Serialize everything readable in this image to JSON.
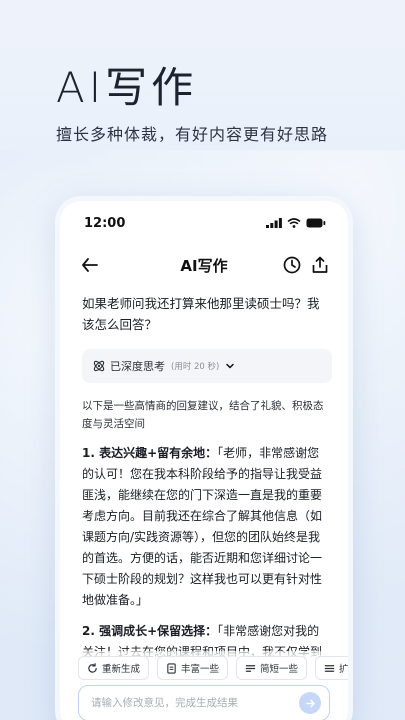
{
  "hero": {
    "title": "AI写作",
    "subtitle": "擅长多种体裁，有好内容更有好思路"
  },
  "status_bar": {
    "time": "12:00"
  },
  "nav": {
    "title": "AI写作",
    "icons": [
      "back-arrow-icon",
      "history-clock-icon",
      "share-icon"
    ]
  },
  "chat": {
    "question": "如果老师问我还打算来他那里读硕士吗？我该怎么回答？",
    "thinking": {
      "label": "已深度思考",
      "duration": "(用时 20 秒)"
    },
    "intro": "以下是一些高情商的回复建议，结合了礼貌、积极态度与灵活空间",
    "points": [
      {
        "head": "1. 表达兴趣+留有余地：",
        "body": "「老师，非常感谢您的认可！您在我本科阶段给予的指导让我受益匪浅，能继续在您的门下深造一直是我的重要考虑方向。目前我还在综合了解其他信息（如课题方向/实践资源等），但您的团队始终是我的首选。方便的话，能否近期和您详细讨论一下硕士阶段的规划？这样我也可以更有针对性地做准备。」"
      },
      {
        "head": "2. 强调成长+保留选择：",
        "body": "「非常感谢您对我的关注！过去在您的课程和项目中，我不仅学到了专业知识，更被您严谨的治学态度深深感染。"
      }
    ]
  },
  "actions": [
    {
      "label": "重新生成",
      "icon": "refresh-icon"
    },
    {
      "label": "丰富一些",
      "icon": "document-icon"
    },
    {
      "label": "简短一些",
      "icon": "shorten-icon"
    },
    {
      "label": "扩写稿",
      "icon": "expand-icon"
    }
  ],
  "input": {
    "placeholder": "请输入修改意见，完成生成结果",
    "value": ""
  },
  "colors": {
    "accent": "#c7d7f7",
    "input_border": "#bfd2f5",
    "background": "#e6eef9"
  }
}
